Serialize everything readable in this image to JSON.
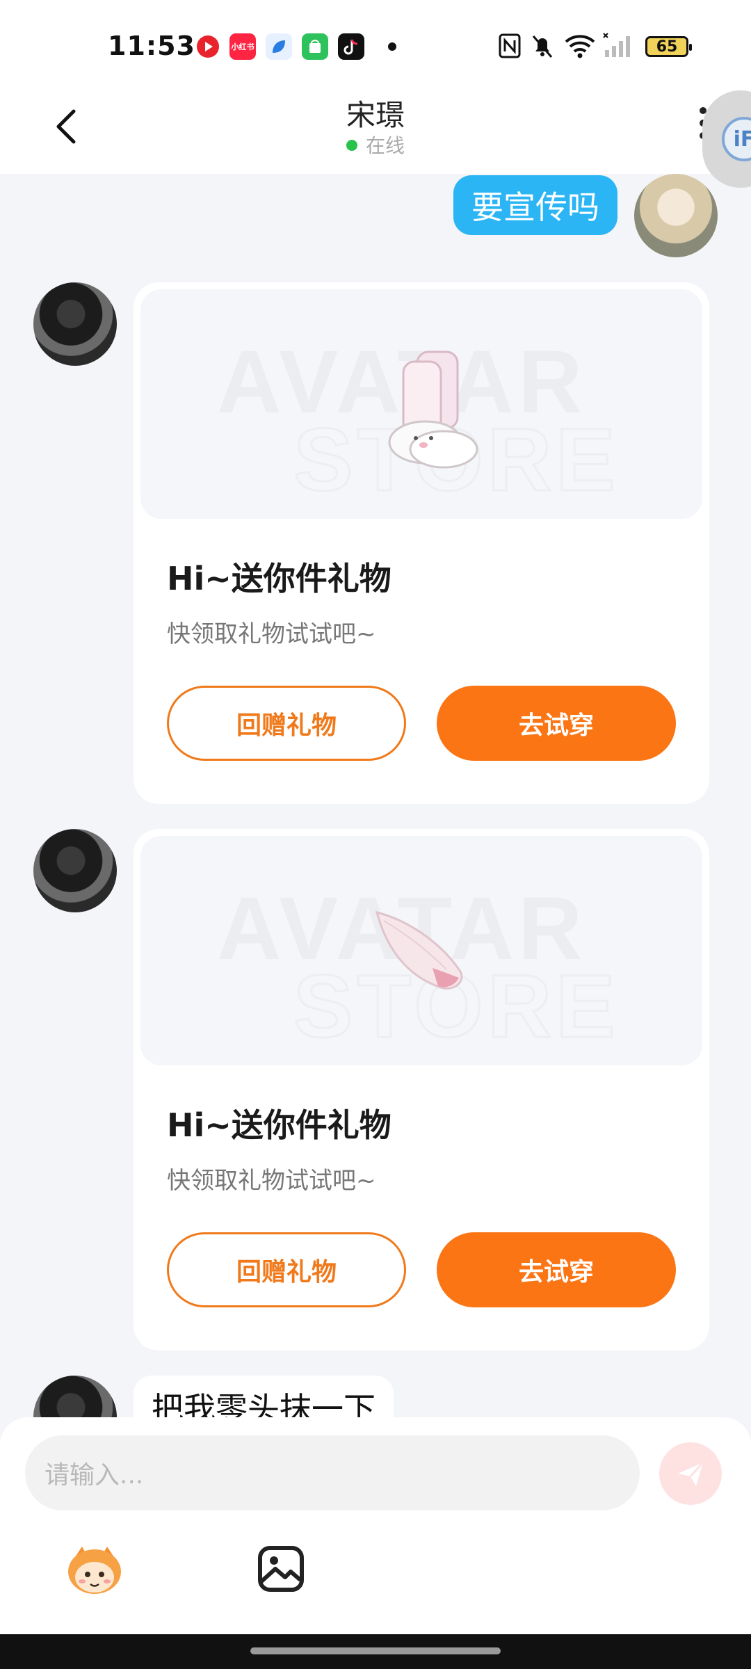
{
  "status_bar": {
    "time": "11:53",
    "battery": "65",
    "app_icons": [
      {
        "name": "video-app-icon",
        "color": "#e8232b"
      },
      {
        "name": "xiaohongshu-icon",
        "color": "#ff2442",
        "label": "小红书"
      },
      {
        "name": "browser-app-icon",
        "color": "#2a7de1"
      },
      {
        "name": "store-app-icon",
        "color": "#2ec25c"
      },
      {
        "name": "tiktok-icon",
        "color": "#111111"
      }
    ]
  },
  "header": {
    "title": "宋璟",
    "status": "在线"
  },
  "messages": {
    "me_text": "要宣传吗",
    "gift_cards": [
      {
        "title": "Hi~送你件礼物",
        "subtitle": "快领取礼物试试吧~",
        "return_label": "回赠礼物",
        "try_label": "去试穿",
        "item_icon": "fluffy-boots-icon"
      },
      {
        "title": "Hi~送你件礼物",
        "subtitle": "快领取礼物试试吧~",
        "return_label": "回赠礼物",
        "try_label": "去试穿",
        "item_icon": "fluffy-tail-icon"
      }
    ],
    "last_text": "把我零头抹一下"
  },
  "input": {
    "placeholder": "请输入..."
  },
  "colors": {
    "accent_orange": "#fb7514",
    "my_bubble": "#2bb5f4",
    "online_dot": "#29c24a"
  }
}
